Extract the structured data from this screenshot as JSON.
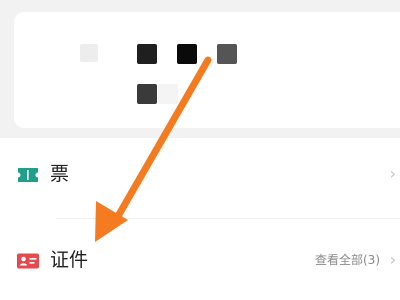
{
  "colors": {
    "ticket_icon": "#1f9e8a",
    "id_icon": "#e5484d",
    "arrow": "#f47b20"
  },
  "list": {
    "tickets": {
      "label": "票",
      "icon": "ticket-icon"
    },
    "ids": {
      "label": "证件",
      "icon": "id-card-icon",
      "value": "查看全部(3)"
    },
    "chevron": "›"
  }
}
